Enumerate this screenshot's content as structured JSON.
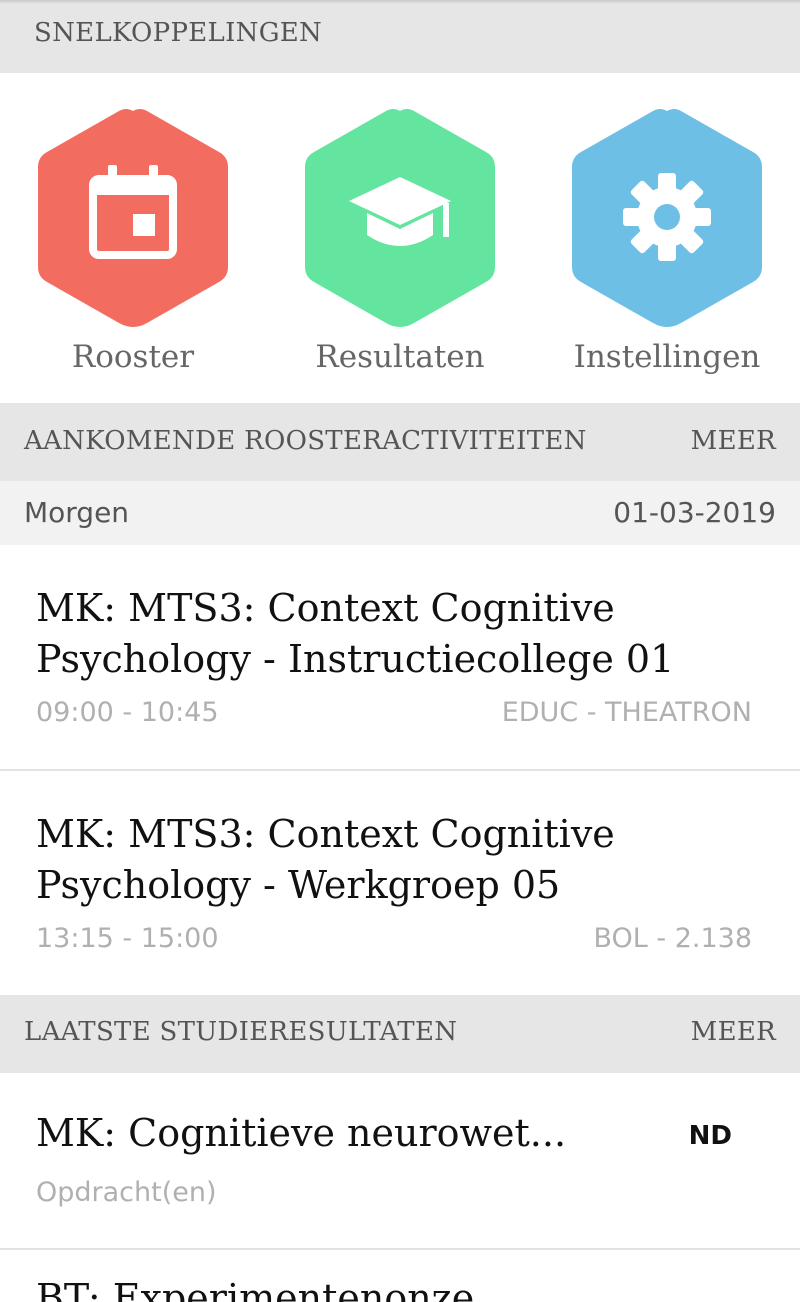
{
  "quick_links": {
    "title": "SNELKOPPELINGEN",
    "items": [
      {
        "label": "Rooster",
        "icon": "calendar-icon",
        "color": "#f26d5f"
      },
      {
        "label": "Resultaten",
        "icon": "graduation-cap-icon",
        "color": "#63e5a0"
      },
      {
        "label": "Instellingen",
        "icon": "gear-icon",
        "color": "#6dbfe6"
      }
    ]
  },
  "schedule": {
    "title": "AANKOMENDE ROOSTERACTIVITEITEN",
    "more_label": "MEER",
    "day_label": "Morgen",
    "date": "01-03-2019",
    "events": [
      {
        "title": "MK: MTS3: Context Cognitive Psychology - Instructiecollege 01",
        "time": "09:00 - 10:45",
        "location": "EDUC - THEATRON"
      },
      {
        "title": "MK: MTS3: Context Cognitive Psychology - Werkgroep 05",
        "time": "13:15 - 15:00",
        "location": "BOL - 2.138"
      }
    ]
  },
  "results": {
    "title": "LAATSTE STUDIERESULTATEN",
    "more_label": "MEER",
    "items": [
      {
        "title": "MK: Cognitieve neurowet...",
        "grade": "ND",
        "type": "Opdracht(en)"
      },
      {
        "title": "BT: Experimentenonze..."
      }
    ]
  }
}
